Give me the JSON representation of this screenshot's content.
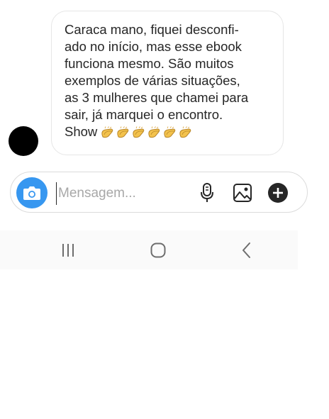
{
  "message": {
    "text": "Caraca mano, fiquei desconfi-\nado no início, mas esse ebook\nfunciona mesmo. São muitos\nexemplos de várias situações,\nas 3 mulheres que chamei para\nsair, já marquei o encontro.\nShow",
    "emojis": [
      "clapping-hands",
      "clapping-hands",
      "clapping-hands",
      "clapping-hands",
      "clapping-hands",
      "clapping-hands"
    ]
  },
  "composer": {
    "placeholder": "Mensagem...",
    "value": "",
    "icons": {
      "camera": "camera-icon",
      "microphone": "microphone-icon",
      "gallery": "image-icon",
      "add": "plus-circle-icon"
    },
    "accent_color": "#3797f0"
  },
  "navigation": {
    "buttons": [
      "recent-apps",
      "home",
      "back"
    ]
  }
}
